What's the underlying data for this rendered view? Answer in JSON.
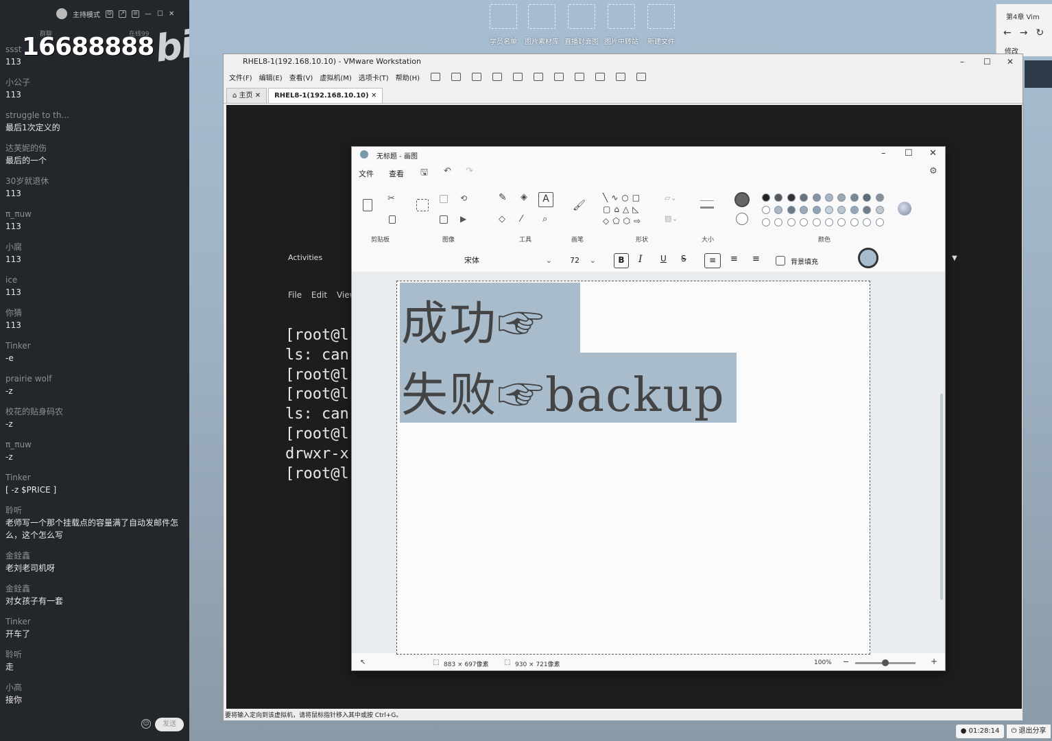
{
  "chat": {
    "header_mode": "主持模式",
    "viewer_count": "16688888",
    "tiny_label_left": "群聊",
    "tiny_label_right": "在线99",
    "logo_text": "bilibili",
    "messages": [
      {
        "user": "ssst",
        "text": "113"
      },
      {
        "user": "小公子",
        "text": "113"
      },
      {
        "user": "struggle to th...",
        "text": "最后1次定义的"
      },
      {
        "user": "达芙妮的伤",
        "text": "最后的一个"
      },
      {
        "user": "30岁就退休",
        "text": "113"
      },
      {
        "user": "π_πuw",
        "text": "113"
      },
      {
        "user": "小腐",
        "text": "113"
      },
      {
        "user": "ice",
        "text": "113"
      },
      {
        "user": "你猜",
        "text": "113"
      },
      {
        "user": "Tinker",
        "text": "-e"
      },
      {
        "user": "prairie wolf",
        "text": "-z"
      },
      {
        "user": "校花的贴身码农",
        "text": "-z"
      },
      {
        "user": "π_πuw",
        "text": "-z"
      },
      {
        "user": "Tinker",
        "text": "[ -z $PRICE ]"
      },
      {
        "user": "聆听",
        "text": "老师写一个那个挂载点的容量满了自动发邮件怎么，这个怎么写"
      },
      {
        "user": "金銓鑫",
        "text": "老刘老司机呀"
      },
      {
        "user": "金銓鑫",
        "text": "对女孩子有一套"
      },
      {
        "user": "Tinker",
        "text": "开车了"
      },
      {
        "user": "聆听",
        "text": "走"
      },
      {
        "user": "小高",
        "text": "接你"
      }
    ],
    "send_label": "发送"
  },
  "desktop": {
    "icons": [
      "学员名单",
      "图片素材库",
      "直播封面图",
      "图片中转站",
      "新建文件"
    ],
    "corner_title": "第4章 Vim",
    "corner_action": "修改"
  },
  "vmware": {
    "title": "RHEL8-1(192.168.10.10) - VMware Workstation",
    "menu": [
      "文件(F)",
      "编辑(E)",
      "查看(V)",
      "虚拟机(M)",
      "选项卡(T)",
      "帮助(H)"
    ],
    "tabs": [
      "主页",
      "RHEL8-1(192.168.10.10)"
    ],
    "status": "要将输入定向到该虚拟机，请将鼠标指针移入其中或按 Ctrl+G。",
    "guest": {
      "activities": "Activities",
      "term_menu": "File  Edit  View",
      "lines": [
        "[root@l",
        "ls: can",
        "[root@l",
        "[root@l",
        "ls: can",
        "[root@l",
        "drwxr-x",
        "[root@l"
      ]
    }
  },
  "paint": {
    "title": "无标题 - 画图",
    "menu_file": "文件",
    "menu_view": "查看",
    "groups": {
      "clipboard": "剪贴板",
      "image": "图像",
      "tools": "工具",
      "brushes": "画笔",
      "shapes": "形状",
      "size": "大小",
      "colors": "颜色"
    },
    "font_name": "宋体",
    "font_size": "72",
    "bg_fill_label": "背景填充",
    "canvas_line1": "成功☞",
    "canvas_line2": "失败☞backup",
    "status_selection": "883 × 697像素",
    "status_canvas": "930 × 721像素",
    "zoom": "100%",
    "zoom_level": 0.5,
    "palette_row1": [
      "#222222",
      "#555a60",
      "#333333",
      "#6a7280",
      "#8594a4",
      "#a7b6c4",
      "#9aa8b4",
      "#788696",
      "#5e6c78",
      "#8a9098"
    ],
    "palette_row2": [
      "#ffffff",
      "#a9b8c6",
      "#6c7a88",
      "#9aaab8",
      "#90a4b6",
      "#c6d2dc",
      "#b8c6d2",
      "#96a8b8",
      "#707c88",
      "#c0c8d0"
    ]
  },
  "clock": "01:28:14",
  "exit_share": "退出分享"
}
